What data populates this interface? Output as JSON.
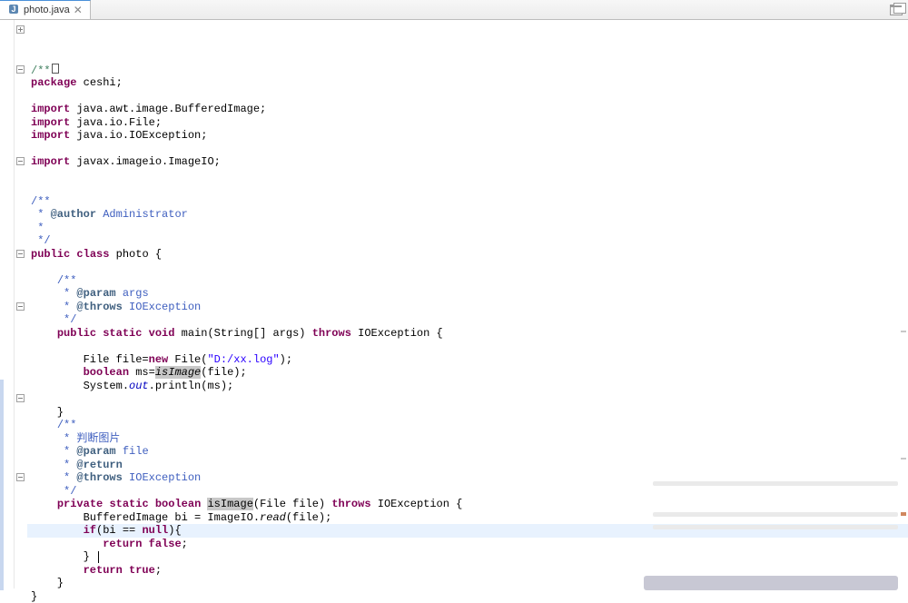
{
  "tab": {
    "filename": "photo.java",
    "close_glyph": "✕"
  },
  "folds": [
    {
      "line": 0,
      "kind": "plus"
    },
    {
      "line": 3,
      "kind": "minus"
    },
    {
      "line": 10,
      "kind": "minus"
    },
    {
      "line": 17,
      "kind": "minus"
    },
    {
      "line": 21,
      "kind": "minus"
    },
    {
      "line": 28,
      "kind": "minus"
    },
    {
      "line": 34,
      "kind": "minus"
    }
  ],
  "change_bars": [
    {
      "from": 27,
      "to": 42
    }
  ],
  "current_line_index": 38,
  "code": {
    "lines": [
      [
        [
          "com",
          "/**"
        ],
        [
          "cursorbox",
          ""
        ]
      ],
      [
        [
          "kw",
          "package"
        ],
        [
          "",
          " ceshi;"
        ]
      ],
      [
        [
          "",
          ""
        ]
      ],
      [
        [
          "kw",
          "import"
        ],
        [
          "",
          " java.awt.image.BufferedImage;"
        ]
      ],
      [
        [
          "kw",
          "import"
        ],
        [
          "",
          " java.io.File;"
        ]
      ],
      [
        [
          "kw",
          "import"
        ],
        [
          "",
          " java.io.IOException;"
        ]
      ],
      [
        [
          "",
          ""
        ]
      ],
      [
        [
          "kw",
          "import"
        ],
        [
          "",
          " javax.imageio.ImageIO;"
        ]
      ],
      [
        [
          "",
          ""
        ]
      ],
      [
        [
          "",
          ""
        ]
      ],
      [
        [
          "doc",
          "/**"
        ]
      ],
      [
        [
          "doc",
          " * "
        ],
        [
          "doctag",
          "@author"
        ],
        [
          "doc",
          " Administrator"
        ]
      ],
      [
        [
          "doc",
          " *"
        ]
      ],
      [
        [
          "doc",
          " */"
        ]
      ],
      [
        [
          "kw",
          "public"
        ],
        [
          "",
          " "
        ],
        [
          "kw",
          "class"
        ],
        [
          "",
          " photo {"
        ]
      ],
      [
        [
          "",
          ""
        ]
      ],
      [
        [
          "",
          "    "
        ],
        [
          "doc",
          "/**"
        ]
      ],
      [
        [
          "",
          "    "
        ],
        [
          "doc",
          " * "
        ],
        [
          "doctag",
          "@param"
        ],
        [
          "doc",
          " args"
        ]
      ],
      [
        [
          "",
          "    "
        ],
        [
          "doc",
          " * "
        ],
        [
          "doctag",
          "@throws"
        ],
        [
          "doc",
          " IOException "
        ]
      ],
      [
        [
          "",
          "    "
        ],
        [
          "doc",
          " */"
        ]
      ],
      [
        [
          "",
          "    "
        ],
        [
          "kw",
          "public"
        ],
        [
          "",
          " "
        ],
        [
          "kw",
          "static"
        ],
        [
          "",
          " "
        ],
        [
          "kw",
          "void"
        ],
        [
          "",
          " main(String[] args) "
        ],
        [
          "kw",
          "throws"
        ],
        [
          "",
          " IOException {"
        ]
      ],
      [
        [
          "",
          "        "
        ]
      ],
      [
        [
          "",
          "        File file="
        ],
        [
          "kw",
          "new"
        ],
        [
          "",
          " File("
        ],
        [
          "str",
          "\"D:/xx.log\""
        ],
        [
          "",
          ");"
        ]
      ],
      [
        [
          "",
          "        "
        ],
        [
          "kw",
          "boolean"
        ],
        [
          "",
          " ms="
        ],
        [
          "hl-method",
          "isImage"
        ],
        [
          "",
          "(file);"
        ]
      ],
      [
        [
          "",
          "        System."
        ],
        [
          "static-field",
          "out"
        ],
        [
          "",
          ".println(ms);"
        ]
      ],
      [
        [
          "",
          "        "
        ]
      ],
      [
        [
          "",
          "    }"
        ]
      ],
      [
        [
          "",
          "    "
        ],
        [
          "doc",
          "/**"
        ]
      ],
      [
        [
          "",
          "    "
        ],
        [
          "doc",
          " * 判断图片"
        ]
      ],
      [
        [
          "",
          "    "
        ],
        [
          "doc",
          " * "
        ],
        [
          "doctag",
          "@param"
        ],
        [
          "doc",
          " file"
        ]
      ],
      [
        [
          "",
          "    "
        ],
        [
          "doc",
          " * "
        ],
        [
          "doctag",
          "@return"
        ]
      ],
      [
        [
          "",
          "    "
        ],
        [
          "doc",
          " * "
        ],
        [
          "doctag",
          "@throws"
        ],
        [
          "doc",
          " IOException "
        ]
      ],
      [
        [
          "",
          "    "
        ],
        [
          "doc",
          " */"
        ]
      ],
      [
        [
          "",
          "    "
        ],
        [
          "kw",
          "private"
        ],
        [
          "",
          " "
        ],
        [
          "kw",
          "static"
        ],
        [
          "",
          " "
        ],
        [
          "kw",
          "boolean"
        ],
        [
          "",
          " "
        ],
        [
          "hl-method-def",
          "isImage"
        ],
        [
          "",
          "(File file) "
        ],
        [
          "kw",
          "throws"
        ],
        [
          "",
          " IOException {"
        ]
      ],
      [
        [
          "",
          "        BufferedImage bi = ImageIO."
        ],
        [
          "static-call",
          "read"
        ],
        [
          "",
          "(file);"
        ]
      ],
      [
        [
          "",
          "        "
        ],
        [
          "kw",
          "if"
        ],
        [
          "",
          "(bi == "
        ],
        [
          "kw",
          "null"
        ],
        [
          "",
          "){"
        ]
      ],
      [
        [
          "",
          "           "
        ],
        [
          "kw",
          "return"
        ],
        [
          "",
          " "
        ],
        [
          "kw",
          "false"
        ],
        [
          "",
          ";"
        ]
      ],
      [
        [
          "",
          "        } "
        ],
        [
          "caret",
          ""
        ]
      ],
      [
        [
          "",
          "        "
        ],
        [
          "kw",
          "return"
        ],
        [
          "",
          " "
        ],
        [
          "kw",
          "true"
        ],
        [
          "",
          ";"
        ]
      ],
      [
        [
          "",
          "    }"
        ]
      ],
      [
        [
          "",
          "}"
        ]
      ]
    ]
  }
}
